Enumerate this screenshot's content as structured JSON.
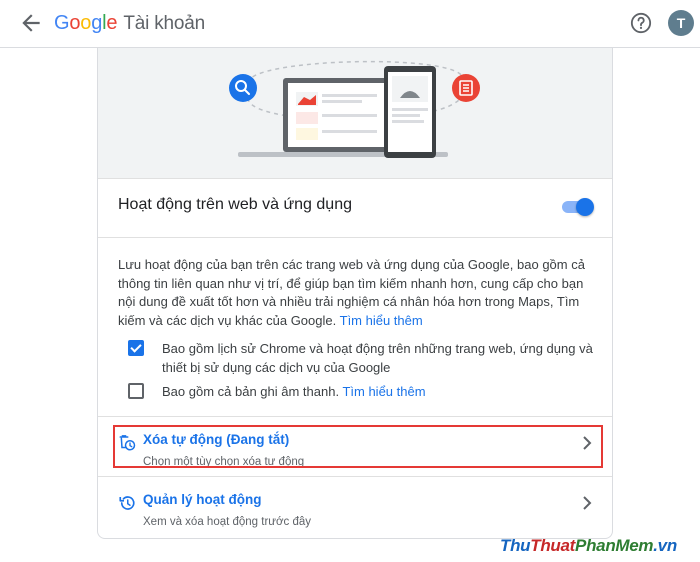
{
  "app": {
    "brand_letters": [
      "G",
      "o",
      "o",
      "g",
      "l",
      "e"
    ],
    "account_label": "Tài khoản",
    "avatar_letter": "T"
  },
  "activity": {
    "title": "Hoạt động trên web và ứng dụng",
    "toggle_on": true,
    "description": "Lưu hoạt động của bạn trên các trang web và ứng dụng của Google, bao gồm cả thông tin liên quan như vị trí, để giúp bạn tìm kiếm nhanh hơn, cung cấp cho bạn nội dung đề xuất tốt hơn và nhiều trải nghiệm cá nhân hóa hơn trong Maps, Tìm kiếm và các dịch vụ khác của Google.",
    "learn_more": "Tìm hiểu thêm",
    "options": [
      {
        "checked": true,
        "text": "Bao gồm lịch sử Chrome và hoạt động trên những trang web, ứng dụng và thiết bị sử dụng các dịch vụ của Google"
      },
      {
        "checked": false,
        "text": "Bao gồm cả bản ghi âm thanh.",
        "link": "Tìm hiểu thêm"
      }
    ]
  },
  "rows": [
    {
      "title": "Xóa tự động (Đang tắt)",
      "subtitle": "Chọn một tùy chọn xóa tự động",
      "icon": "auto-delete-icon"
    },
    {
      "title": "Quản lý hoạt động",
      "subtitle": "Xem và xóa hoạt động trước đây",
      "icon": "history-icon"
    }
  ],
  "watermark": [
    "Thu",
    "Thuat",
    "PhanMem",
    ".vn"
  ],
  "colors": {
    "accent": "#1a73e8",
    "highlight": "#e53935"
  }
}
